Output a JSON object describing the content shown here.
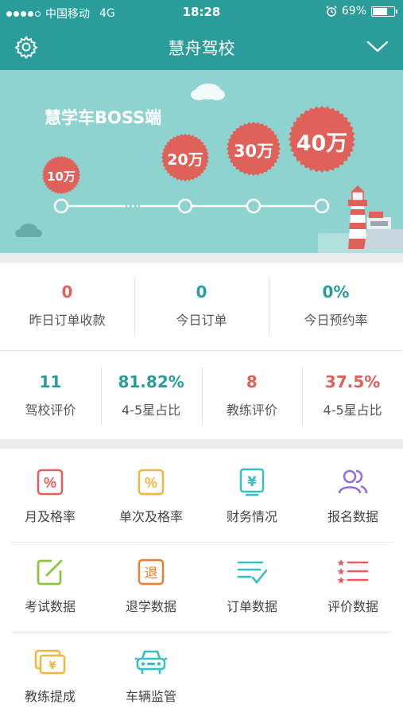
{
  "status_bar": {
    "carrier": "中国移动",
    "network": "4G",
    "time": "18:28",
    "battery_percent": "69%",
    "battery_level": 0.69
  },
  "nav": {
    "title": "慧舟驾校",
    "left_icon": "gear-icon",
    "right_icon": "chevron-down-icon"
  },
  "banner": {
    "title": "慧学车BOSS端",
    "badges": [
      "10万",
      "20万",
      "30万",
      "40万"
    ],
    "background": "#8ed3d0",
    "badge_color": "#e0605a"
  },
  "stats_primary": [
    {
      "value": "0",
      "label": "昨日订单收款",
      "color": "#e0605a"
    },
    {
      "value": "0",
      "label": "今日订单",
      "color": "#2a9d9b"
    },
    {
      "value": "0%",
      "label": "今日预约率",
      "color": "#2a9d9b"
    }
  ],
  "stats_secondary": [
    {
      "value": "11",
      "label": "驾校评价",
      "color": "#2a9d9b"
    },
    {
      "value": "81.82%",
      "label": "4-5星占比",
      "color": "#2a9d9b"
    },
    {
      "value": "8",
      "label": "教练评价",
      "color": "#e0605a"
    },
    {
      "value": "37.5%",
      "label": "4-5星占比",
      "color": "#e0605a"
    }
  ],
  "menu": [
    {
      "label": "月及格率",
      "icon": "percent-icon"
    },
    {
      "label": "单次及格率",
      "icon": "percent-icon"
    },
    {
      "label": "财务情况",
      "icon": "yen-icon"
    },
    {
      "label": "报名数据",
      "icon": "users-icon"
    },
    {
      "label": "考试数据",
      "icon": "edit-icon"
    },
    {
      "label": "退学数据",
      "icon": "withdraw-icon"
    },
    {
      "label": "订单数据",
      "icon": "checklist-icon"
    },
    {
      "label": "评价数据",
      "icon": "star-list-icon"
    },
    {
      "label": "教练提成",
      "icon": "money-cards-icon"
    },
    {
      "label": "车辆监管",
      "icon": "car-icon"
    }
  ],
  "icon_glyphs": {
    "percent": "%",
    "yen": "¥",
    "withdraw": "退"
  },
  "colors": {
    "primary": "#2a9d9b",
    "accent_red": "#e0605a",
    "menu_red": "#e85c5c",
    "menu_yellow": "#f5b63c",
    "menu_teal": "#35bfc3",
    "menu_purple": "#8e6be0",
    "menu_green": "#8cc63f",
    "menu_orange": "#ee7d2f"
  }
}
